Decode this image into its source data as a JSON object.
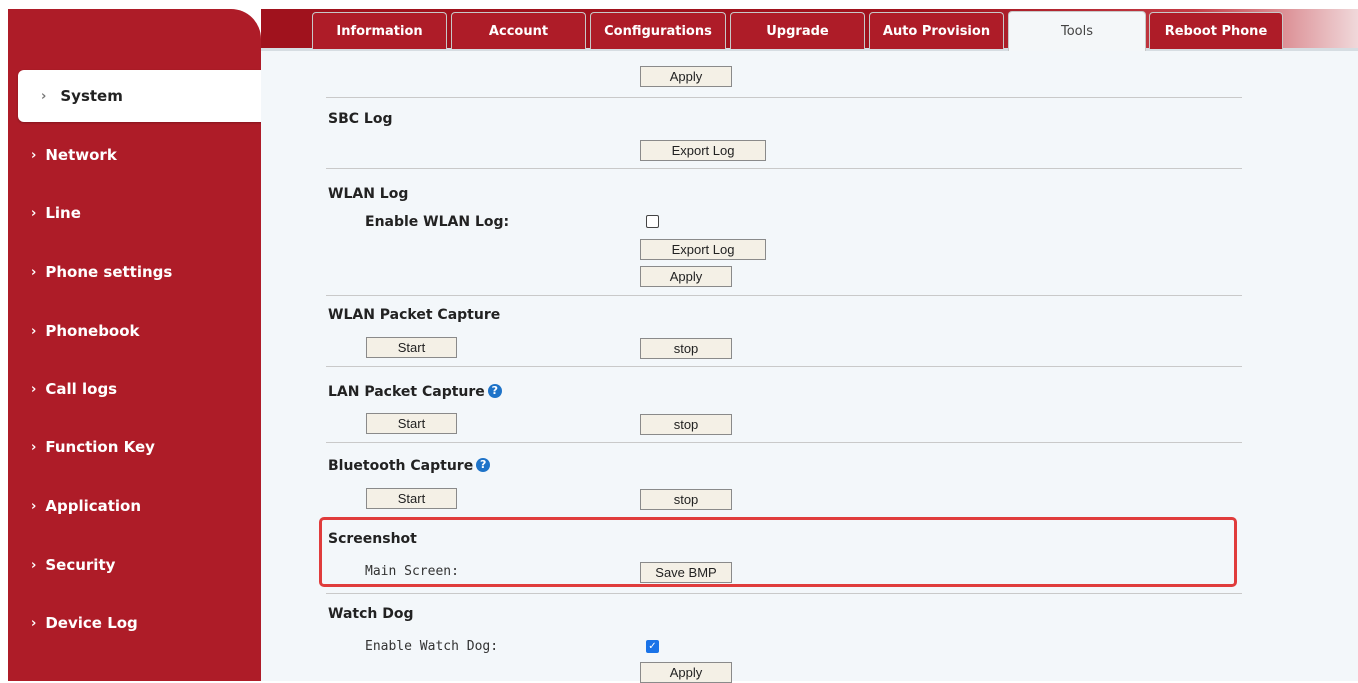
{
  "tabs": [
    "Information",
    "Account",
    "Configurations",
    "Upgrade",
    "Auto Provision",
    "Tools",
    "Reboot Phone"
  ],
  "sidebar": {
    "items": [
      "System",
      "Network",
      "Line",
      "Phone settings",
      "Phonebook",
      "Call logs",
      "Function Key",
      "Application",
      "Security",
      "Device Log"
    ]
  },
  "top": {
    "apply": "Apply"
  },
  "sbc_log": {
    "title": "SBC Log",
    "export": "Export Log"
  },
  "wlan_log": {
    "title": "WLAN Log",
    "enable_label": "Enable WLAN Log:",
    "enabled": false,
    "export": "Export Log",
    "apply": "Apply"
  },
  "wlan_capture": {
    "title": "WLAN Packet Capture",
    "start": "Start",
    "stop": "stop"
  },
  "lan_capture": {
    "title": "LAN Packet Capture",
    "start": "Start",
    "stop": "stop"
  },
  "bt_capture": {
    "title": "Bluetooth Capture",
    "start": "Start",
    "stop": "stop"
  },
  "screenshot": {
    "title": "Screenshot",
    "label": "Main Screen:",
    "button": "Save BMP"
  },
  "watchdog": {
    "title": "Watch Dog",
    "enable_label": "Enable Watch Dog:",
    "enabled": true,
    "apply": "Apply"
  },
  "colors": {
    "brand": "#ae1c28",
    "highlight": "#e03c3c",
    "content_bg": "#f3f7fa"
  }
}
